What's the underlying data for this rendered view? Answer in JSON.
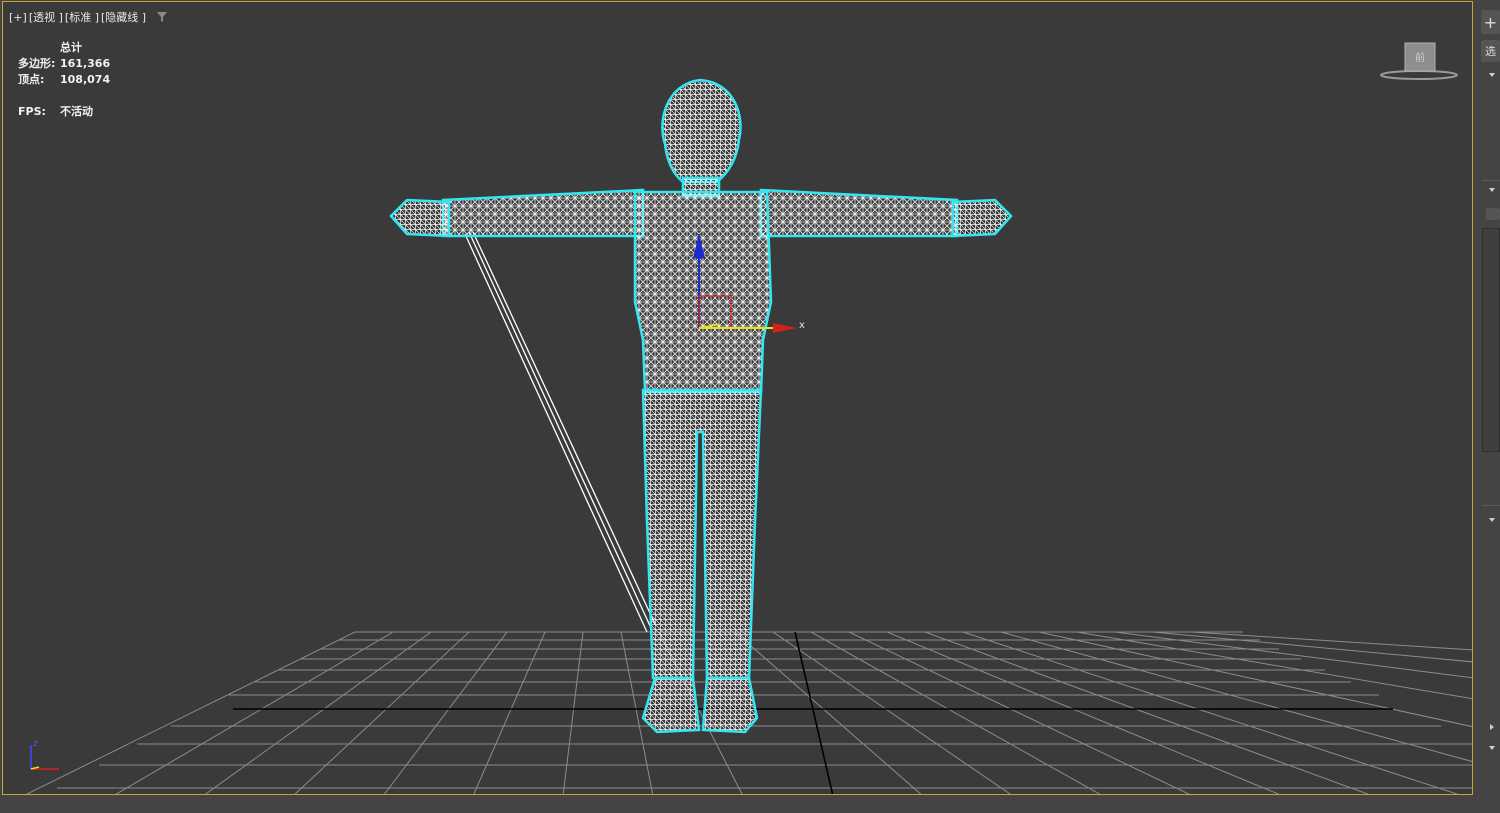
{
  "viewport": {
    "label_items": [
      "[+]",
      "[透视 ]",
      "[标准 ]",
      "[隐藏线 ]"
    ],
    "stats": {
      "header": "总计",
      "polygons_label": "多边形:",
      "polygons_value": "161,366",
      "vertices_label": "顶点:",
      "vertices_value": "108,074",
      "fps_label": "FPS:",
      "fps_value": "不活动"
    },
    "viewcube_face": "前",
    "gizmo_x_label": "x",
    "tripod_z_label": "z"
  },
  "right_panel": {
    "plus_button": "+",
    "select_label": "选"
  },
  "colors": {
    "viewport_bg": "#3a3a3a",
    "viewport_border": "#c9a632",
    "selection_outline": "#33e6f0",
    "wireframe": "#ffffff",
    "axis_x": "#d61f1f",
    "axis_y": "#e8e01a",
    "axis_z": "#2030d0"
  }
}
